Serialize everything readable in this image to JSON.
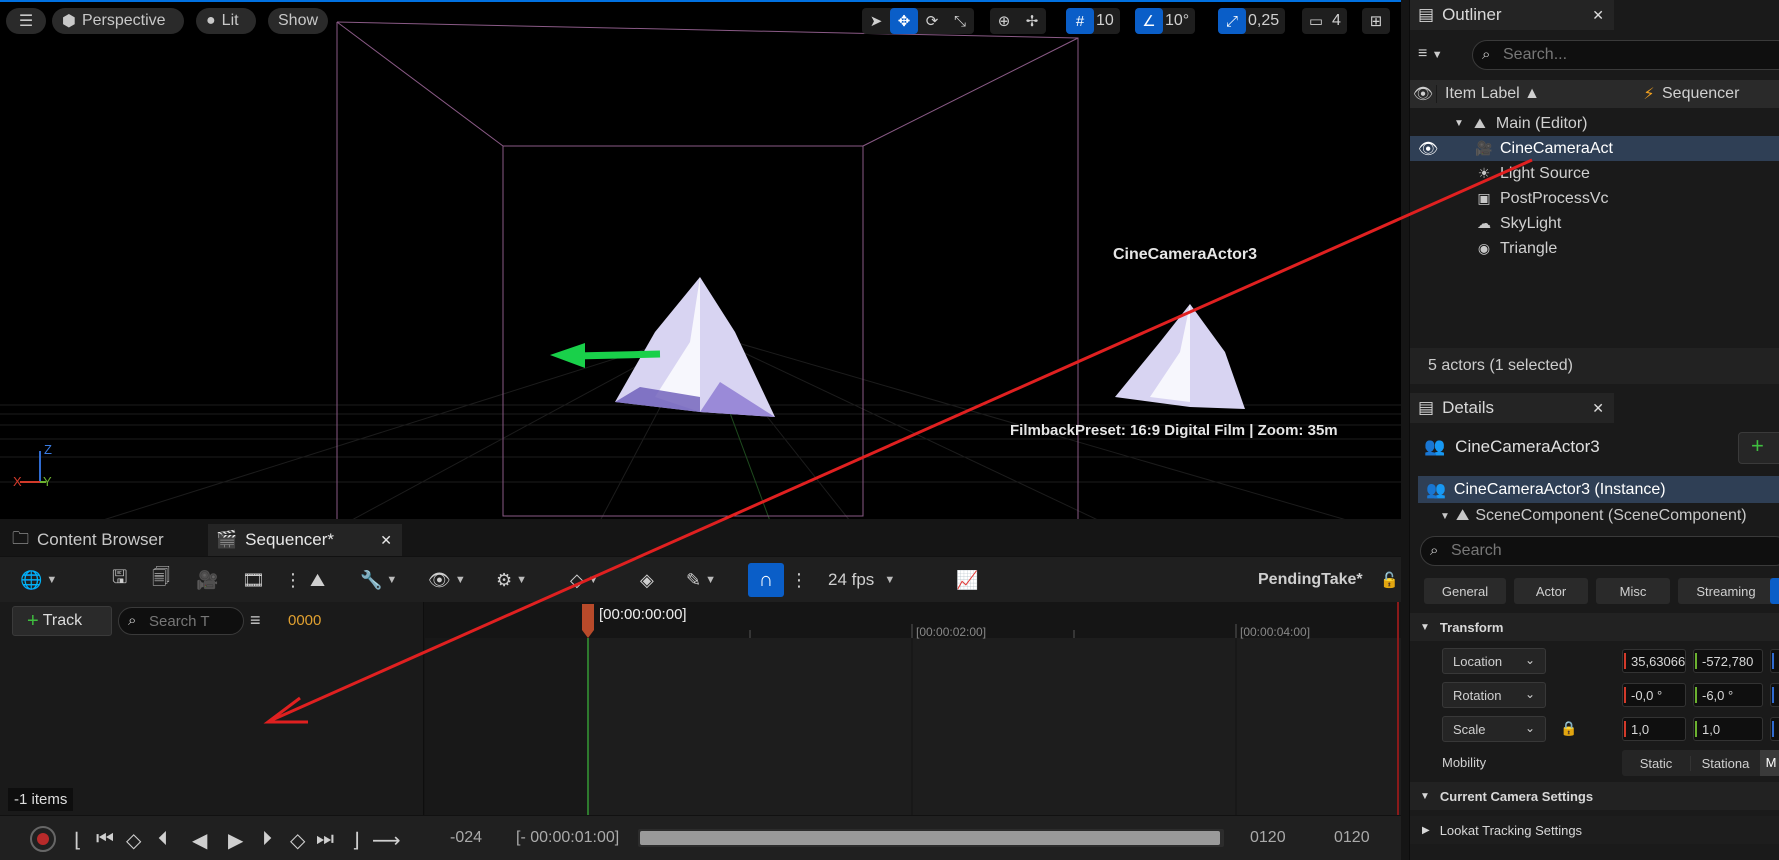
{
  "viewport": {
    "menu_icon": "hamburger-icon",
    "perspective_label": "Perspective",
    "lit_label": "Lit",
    "show_label": "Show",
    "grid_snap_value": "10",
    "rotation_snap_value": "10°",
    "scale_snap_value": "0,25",
    "camera_speed_value": "4",
    "camera_actor_label": "CineCameraActor3",
    "camera_info_text": "FilmbackPreset: 16:9 Digital Film | Zoom: 35m",
    "axis_z": "Z",
    "axis_x": "X",
    "axis_y": "Y"
  },
  "outliner": {
    "title": "Outliner",
    "search_placeholder": "Search...",
    "col_item_label": "Item Label ▲",
    "col_sequencer": "Sequencer",
    "items": [
      {
        "label": "Main (Editor)",
        "icon": "level-icon"
      },
      {
        "label": "CineCameraAct",
        "icon": "camera-icon"
      },
      {
        "label": "Light Source",
        "icon": "sun-icon"
      },
      {
        "label": "PostProcessVc",
        "icon": "postprocess-icon"
      },
      {
        "label": "SkyLight",
        "icon": "skylight-icon"
      },
      {
        "label": "Triangle",
        "icon": "sphere-icon"
      }
    ],
    "status": "5 actors (1 selected)"
  },
  "details": {
    "title": "Details",
    "actor_name": "CineCameraActor3",
    "instance_label": "CineCameraActor3 (Instance)",
    "component_label": "SceneComponent (SceneComponent)",
    "search_placeholder": "Search",
    "categories": [
      "General",
      "Actor",
      "Misc",
      "Streaming"
    ],
    "transform_header": "Transform",
    "location_label": "Location",
    "location_x": "35,63066",
    "location_y": "-572,780",
    "rotation_label": "Rotation",
    "rotation_x": "-0,0 °",
    "rotation_y": "-6,0 °",
    "scale_label": "Scale",
    "scale_x": "1,0",
    "scale_y": "1,0",
    "mobility_label": "Mobility",
    "mobility_static": "Static",
    "mobility_stationary": "Stationa",
    "mobility_movable": "M",
    "camera_settings_header": "Current Camera Settings",
    "lookat_header": "Lookat Tracking Settings"
  },
  "bottom_tabs": {
    "content_browser": "Content Browser",
    "sequencer": "Sequencer*"
  },
  "sequencer": {
    "fps_label": "24 fps",
    "take_label": "PendingTake*",
    "add_track_label": "Track",
    "search_placeholder": "Search T",
    "current_frame": "0000",
    "items_count": "-1 items",
    "playhead_time": "[00:00:00:00]",
    "ruler_marks": [
      "[00:00:02:00]",
      "[00:00:04:00]"
    ],
    "start_frame": "-024",
    "view_start": "[- 00:00:01:00]",
    "end_frame_a": "0120",
    "end_frame_b": "0120"
  }
}
